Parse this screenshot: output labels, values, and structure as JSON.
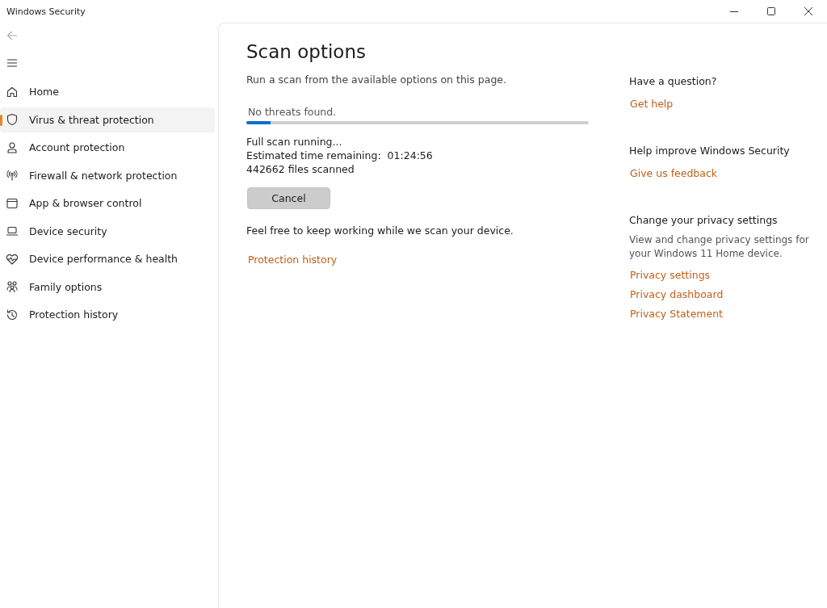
{
  "window": {
    "title": "Windows Security"
  },
  "sidebar": {
    "items": [
      {
        "label": "Home",
        "selected": false
      },
      {
        "label": "Virus & threat protection",
        "selected": true
      },
      {
        "label": "Account protection",
        "selected": false
      },
      {
        "label": "Firewall & network protection",
        "selected": false
      },
      {
        "label": "App & browser control",
        "selected": false
      },
      {
        "label": "Device security",
        "selected": false
      },
      {
        "label": "Device performance & health",
        "selected": false
      },
      {
        "label": "Family options",
        "selected": false
      },
      {
        "label": "Protection history",
        "selected": false
      }
    ]
  },
  "main": {
    "title": "Scan options",
    "subtitle": "Run a scan from the available options on this page.",
    "status": "No threats found.",
    "progress": {
      "level": 0.07
    },
    "scan_lines": [
      "Full scan running...",
      "Estimated time remaining:  01:24:56",
      "442662 files scanned"
    ],
    "cancel_button": "Cancel",
    "note": "Feel free to keep working while we scan your device.",
    "link": "Protection history"
  },
  "aside": [
    {
      "heading": "Have a question?",
      "links": [
        "Get help"
      ]
    },
    {
      "heading": "Help improve Windows Security",
      "links": [
        "Give us feedback"
      ]
    },
    {
      "heading": "Change your privacy settings",
      "text": "View and change privacy settings for your Windows 11 Home device.",
      "links": [
        "Privacy settings",
        "Privacy dashboard",
        "Privacy Statement"
      ]
    }
  ]
}
